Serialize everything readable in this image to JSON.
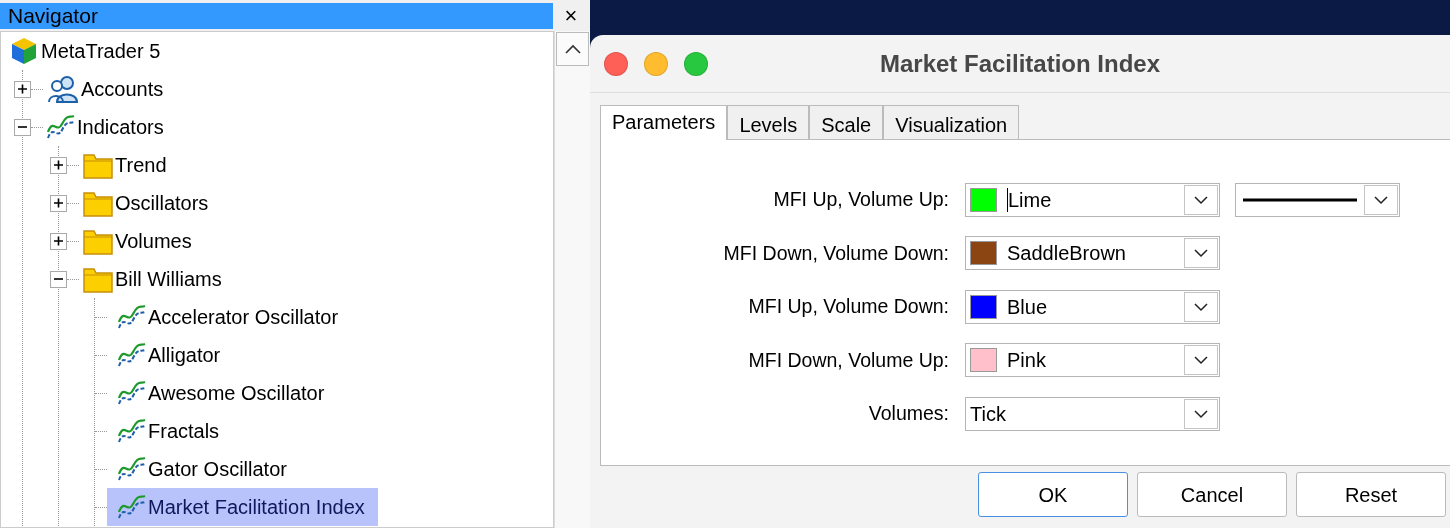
{
  "navigator": {
    "title": "Navigator",
    "close": "×",
    "tree": [
      {
        "label": "MetaTrader 5",
        "kind": "logo",
        "selected": false,
        "children": [
          {
            "label": "Accounts",
            "kind": "accounts",
            "expanded": false,
            "selected": false
          },
          {
            "label": "Indicators",
            "kind": "indicator",
            "expanded": true,
            "selected": false,
            "children": [
              {
                "label": "Trend",
                "kind": "folder",
                "expanded": false,
                "selected": false
              },
              {
                "label": "Oscillators",
                "kind": "folder",
                "expanded": false,
                "selected": false
              },
              {
                "label": "Volumes",
                "kind": "folder",
                "expanded": false,
                "selected": false
              },
              {
                "label": "Bill Williams",
                "kind": "folder",
                "expanded": true,
                "selected": false,
                "children": [
                  {
                    "label": "Accelerator Oscillator",
                    "kind": "indicator",
                    "selected": false
                  },
                  {
                    "label": "Alligator",
                    "kind": "indicator",
                    "selected": false
                  },
                  {
                    "label": "Awesome Oscillator",
                    "kind": "indicator",
                    "selected": false
                  },
                  {
                    "label": "Fractals",
                    "kind": "indicator",
                    "selected": false
                  },
                  {
                    "label": "Gator Oscillator",
                    "kind": "indicator",
                    "selected": false
                  },
                  {
                    "label": "Market Facilitation Index",
                    "kind": "indicator",
                    "selected": true
                  }
                ]
              }
            ]
          }
        ]
      }
    ]
  },
  "dialog": {
    "title": "Market Facilitation Index",
    "tabs": [
      {
        "label": "Parameters",
        "selected": true
      },
      {
        "label": "Levels",
        "selected": false
      },
      {
        "label": "Scale",
        "selected": false
      },
      {
        "label": "Visualization",
        "selected": false
      }
    ],
    "params": [
      {
        "label": "MFI Up, Volume Up:",
        "kind": "color",
        "color": "#00ff00",
        "value": "Lime",
        "focused": true,
        "line_style": true
      },
      {
        "label": "MFI Down, Volume Down:",
        "kind": "color",
        "color": "#8b4513",
        "value": "SaddleBrown",
        "focused": false,
        "line_style": false
      },
      {
        "label": "MFI Up, Volume Down:",
        "kind": "color",
        "color": "#0000ff",
        "value": "Blue",
        "focused": false,
        "line_style": false
      },
      {
        "label": "MFI Down, Volume Up:",
        "kind": "color",
        "color": "#ffc0cb",
        "value": "Pink",
        "focused": false,
        "line_style": false
      },
      {
        "label": "Volumes:",
        "kind": "select",
        "value": "Tick",
        "focused": false,
        "line_style": false
      }
    ],
    "buttons": [
      {
        "label": "OK",
        "default": true
      },
      {
        "label": "Cancel",
        "default": false
      },
      {
        "label": "Reset",
        "default": false
      }
    ]
  }
}
